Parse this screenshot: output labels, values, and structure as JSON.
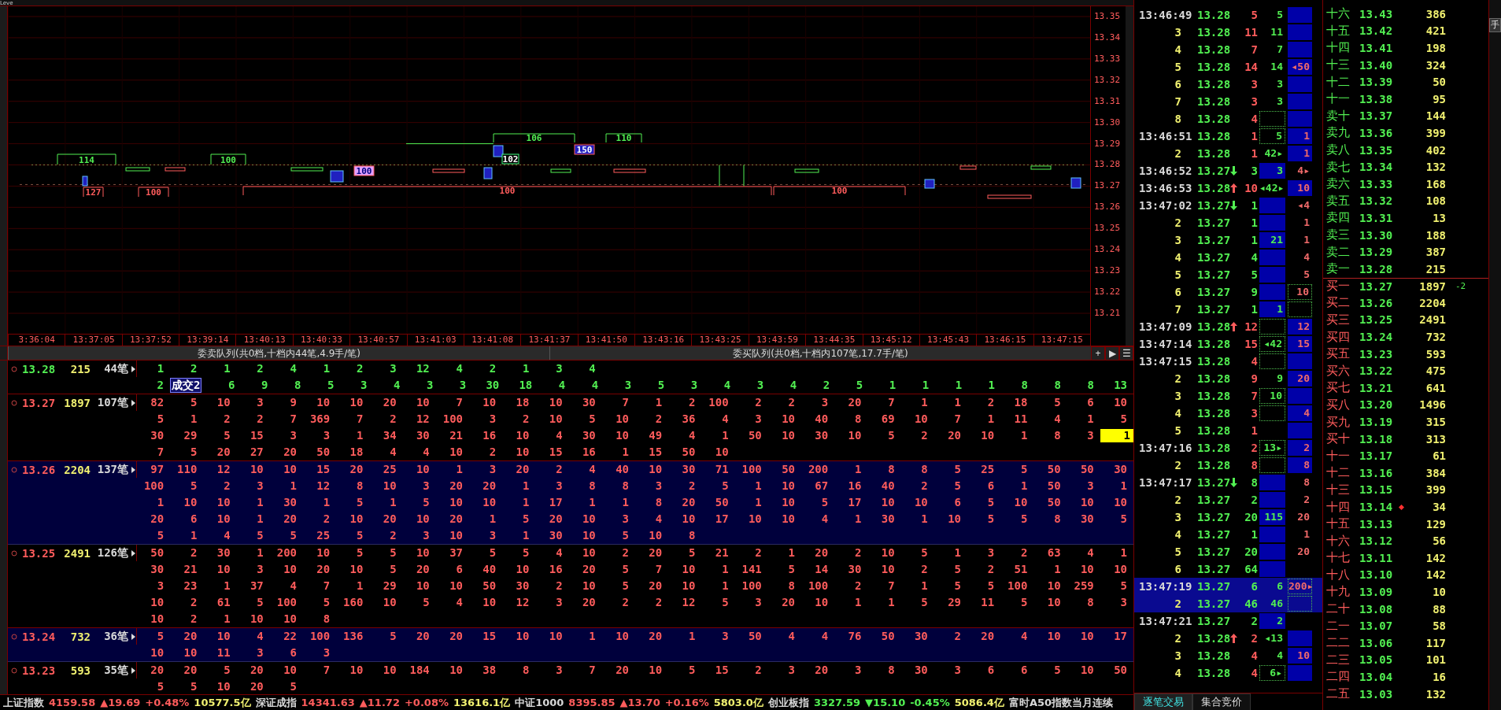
{
  "corner_label": "Leve",
  "chart": {
    "y_axis": [
      "13.35",
      "13.34",
      "13.33",
      "13.32",
      "13.31",
      "13.30",
      "13.29",
      "13.28",
      "13.27",
      "13.26",
      "13.25",
      "13.24",
      "13.23",
      "13.22",
      "13.21"
    ],
    "x_axis": [
      "3:36:04",
      "13:37:05",
      "13:37:52",
      "13:39:14",
      "13:40:13",
      "13:40:33",
      "13:40:57",
      "13:41:03",
      "13:41:08",
      "13:41:37",
      "13:41:50",
      "13:43:16",
      "13:43:25",
      "13:43:59",
      "13:44:35",
      "13:45:12",
      "13:45:43",
      "13:46:15",
      "13:47:15"
    ],
    "blocks": [
      {
        "label": "114",
        "kind": "ask"
      },
      {
        "label": "100",
        "kind": "ask"
      },
      {
        "label": "106",
        "kind": "ask"
      },
      {
        "label": "110",
        "kind": "ask"
      },
      {
        "label": "150",
        "kind": "filled"
      },
      {
        "label": "102",
        "kind": "marked"
      },
      {
        "label": "100",
        "kind": "pink"
      },
      {
        "label": "127",
        "kind": "bid"
      },
      {
        "label": "100",
        "kind": "bid"
      },
      {
        "label": "100",
        "kind": "bid"
      },
      {
        "label": "100",
        "kind": "bid"
      }
    ]
  },
  "queue_header": {
    "sell_title": "委卖队列(共0档,十档内44笔,4.9手/笔)",
    "buy_title": "委买队列(共0档,十档内107笔,17.7手/笔)",
    "buttons": [
      "+",
      "▶",
      "☰"
    ]
  },
  "levels": [
    {
      "price": "13.28",
      "volume": "215",
      "orders": "44笔",
      "kind": "ask",
      "shaded": false,
      "lines": [
        [
          "1",
          "2",
          "1",
          "2",
          "4",
          "1",
          "2",
          "3",
          "12",
          "4",
          "2",
          "1",
          "3",
          "4"
        ],
        [
          "2",
          {
            "text": "成交2",
            "kind": "trade"
          },
          "6",
          "9",
          "8",
          "5",
          "3",
          "4",
          "3",
          "3",
          "30",
          "18",
          "4",
          "4",
          "3",
          "5",
          "3",
          "4",
          "3",
          "4",
          "2",
          "5",
          "1",
          "1",
          "1",
          "1",
          "8",
          "8",
          "8",
          "13"
        ]
      ]
    },
    {
      "price": "13.27",
      "volume": "1897",
      "orders": "107笔",
      "kind": "bid",
      "shaded": false,
      "lines": [
        [
          "82",
          "5",
          "10",
          "3",
          "9",
          "10",
          "10",
          "20",
          "10",
          "7",
          "10",
          "18",
          "10",
          "30",
          "7",
          "1",
          "2",
          "100",
          "2",
          "2",
          "3",
          "20",
          "7",
          "1",
          "1",
          "2",
          "18",
          "5",
          "6",
          "10"
        ],
        [
          "5",
          "1",
          "2",
          "2",
          "7",
          "369",
          "7",
          "2",
          "12",
          "100",
          "3",
          "2",
          "10",
          "5",
          "10",
          "2",
          "36",
          "4",
          "3",
          "10",
          "40",
          "8",
          "69",
          "10",
          "7",
          "1",
          "11",
          "4",
          "1",
          "5"
        ],
        [
          "30",
          "29",
          "5",
          "15",
          "3",
          "3",
          "1",
          "34",
          "30",
          "21",
          "16",
          "10",
          "4",
          "30",
          "10",
          "49",
          "4",
          "1",
          "50",
          "10",
          "30",
          "10",
          "5",
          "2",
          "20",
          "10",
          "1",
          "8",
          "3",
          {
            "text": "1",
            "kind": "cursor"
          }
        ],
        [
          "7",
          "5",
          "20",
          "27",
          "20",
          "50",
          "18",
          "4",
          "4",
          "10",
          "2",
          "10",
          "15",
          "16",
          "1",
          "15",
          "50",
          "10"
        ]
      ]
    },
    {
      "price": "13.26",
      "volume": "2204",
      "orders": "137笔",
      "kind": "bid",
      "shaded": true,
      "lines": [
        [
          "97",
          "110",
          "12",
          "10",
          "10",
          "15",
          "20",
          "25",
          "10",
          "1",
          "3",
          "20",
          "2",
          "4",
          "40",
          "10",
          "30",
          "71",
          "100",
          "50",
          "200",
          "1",
          "8",
          "8",
          "5",
          "25",
          "5",
          "50",
          "50",
          "30"
        ],
        [
          "100",
          "5",
          "2",
          "3",
          "1",
          "12",
          "8",
          "10",
          "3",
          "20",
          "20",
          "1",
          "3",
          "8",
          "8",
          "3",
          "2",
          "5",
          "1",
          "10",
          "67",
          "16",
          "40",
          "2",
          "5",
          "6",
          "1",
          "50",
          "3",
          "1"
        ],
        [
          "1",
          "10",
          "10",
          "1",
          "30",
          "1",
          "5",
          "1",
          "5",
          "10",
          "10",
          "1",
          "17",
          "1",
          "1",
          "8",
          "20",
          "50",
          "1",
          "10",
          "5",
          "17",
          "10",
          "10",
          "6",
          "5",
          "10",
          "50",
          "10",
          "10"
        ],
        [
          "20",
          "6",
          "10",
          "1",
          "20",
          "2",
          "10",
          "20",
          "10",
          "20",
          "1",
          "5",
          "20",
          "10",
          "3",
          "4",
          "10",
          "17",
          "10",
          "10",
          "4",
          "1",
          "30",
          "1",
          "10",
          "5",
          "5",
          "8",
          "30",
          "5"
        ],
        [
          "5",
          "1",
          "4",
          "5",
          "5",
          "25",
          "5",
          "2",
          "3",
          "10",
          "3",
          "1",
          "30",
          "10",
          "5",
          "10",
          "8"
        ]
      ]
    },
    {
      "price": "13.25",
      "volume": "2491",
      "orders": "126笔",
      "kind": "bid",
      "shaded": false,
      "lines": [
        [
          "50",
          "2",
          "30",
          "1",
          "200",
          "10",
          "5",
          "5",
          "10",
          "37",
          "5",
          "5",
          "4",
          "10",
          "2",
          "20",
          "5",
          "21",
          "2",
          "1",
          "20",
          "2",
          "10",
          "5",
          "1",
          "3",
          "2",
          "63",
          "4",
          "1"
        ],
        [
          "30",
          "21",
          "10",
          "3",
          "10",
          "20",
          "10",
          "5",
          "20",
          "6",
          "40",
          "10",
          "16",
          "20",
          "5",
          "7",
          "10",
          "1",
          "141",
          "5",
          "14",
          "30",
          "10",
          "2",
          "5",
          "2",
          "51",
          "1",
          "10",
          "10"
        ],
        [
          "3",
          "23",
          "1",
          "37",
          "4",
          "7",
          "1",
          "29",
          "10",
          "10",
          "50",
          "30",
          "2",
          "10",
          "5",
          "20",
          "10",
          "1",
          "100",
          "8",
          "100",
          "2",
          "7",
          "1",
          "5",
          "5",
          "100",
          "10",
          "259",
          "5"
        ],
        [
          "10",
          "2",
          "61",
          "5",
          "100",
          "5",
          "160",
          "10",
          "5",
          "4",
          "10",
          "12",
          "3",
          "20",
          "2",
          "2",
          "12",
          "5",
          "3",
          "20",
          "10",
          "1",
          "1",
          "5",
          "29",
          "11",
          "5",
          "10",
          "8",
          "3"
        ],
        [
          "10",
          "2",
          "1",
          "10",
          "10",
          "8"
        ]
      ]
    },
    {
      "price": "13.24",
      "volume": "732",
      "orders": "36笔",
      "kind": "bid",
      "shaded": true,
      "lines": [
        [
          "5",
          "20",
          "10",
          "4",
          "22",
          "100",
          "136",
          "5",
          "20",
          "20",
          "15",
          "10",
          "10",
          "1",
          "10",
          "20",
          "1",
          "3",
          "50",
          "4",
          "4",
          "76",
          "50",
          "30",
          "2",
          "20",
          "4",
          "10",
          "10",
          "17"
        ],
        [
          "10",
          "10",
          "11",
          "3",
          "6",
          "3"
        ]
      ]
    },
    {
      "price": "13.23",
      "volume": "593",
      "orders": "35笔",
      "kind": "bid",
      "shaded": false,
      "lines": [
        [
          "20",
          "20",
          "5",
          "20",
          "10",
          "7",
          "10",
          "10",
          "184",
          "10",
          "38",
          "8",
          "3",
          "7",
          "20",
          "10",
          "5",
          "15",
          "2",
          "3",
          "20",
          "3",
          "8",
          "30",
          "3",
          "6",
          "6",
          "5",
          "10",
          "50"
        ],
        [
          "5",
          "5",
          "10",
          "20",
          "5"
        ]
      ]
    }
  ],
  "status_bar": [
    {
      "text": "上证指数",
      "kind": "name"
    },
    {
      "text": "4159.58",
      "kind": "up"
    },
    {
      "text": "▲19.69",
      "kind": "up"
    },
    {
      "text": "+0.48%",
      "kind": "up"
    },
    {
      "text": "10577.5亿",
      "kind": "amount"
    },
    {
      "text": "深证成指",
      "kind": "name"
    },
    {
      "text": "14341.63",
      "kind": "up"
    },
    {
      "text": "▲11.72",
      "kind": "up"
    },
    {
      "text": "+0.08%",
      "kind": "up"
    },
    {
      "text": "13616.1亿",
      "kind": "amount"
    },
    {
      "text": "中证1000",
      "kind": "name"
    },
    {
      "text": "8395.85",
      "kind": "up"
    },
    {
      "text": "▲13.70",
      "kind": "up"
    },
    {
      "text": "+0.16%",
      "kind": "up"
    },
    {
      "text": "5803.0亿",
      "kind": "amount"
    },
    {
      "text": "创业板指",
      "kind": "name"
    },
    {
      "text": "3327.59",
      "kind": "down"
    },
    {
      "text": "▼15.10",
      "kind": "down"
    },
    {
      "text": "-0.45%",
      "kind": "down"
    },
    {
      "text": "5086.4亿",
      "kind": "amount"
    },
    {
      "text": "富时A50指数当月连续",
      "kind": "name"
    }
  ],
  "ticks": [
    {
      "time": "13:46:49",
      "kind": "time",
      "price": "13.28",
      "rising": false,
      "falling": false,
      "volume": "5",
      "buyer": true,
      "buy_hand": {
        "text": "5",
        "kind": "plain"
      },
      "sell_hand": {
        "kind": "solid"
      },
      "selected": false
    },
    {
      "time": "3",
      "kind": "seq",
      "price": "13.28",
      "rising": false,
      "falling": false,
      "volume": "11",
      "buyer": true,
      "buy_hand": {
        "text": "11",
        "kind": "plain"
      },
      "sell_hand": {
        "kind": "solid"
      },
      "selected": false
    },
    {
      "time": "4",
      "kind": "seq",
      "price": "13.28",
      "rising": false,
      "falling": false,
      "volume": "7",
      "buyer": true,
      "buy_hand": {
        "text": "7",
        "kind": "plain"
      },
      "sell_hand": {
        "kind": "solid"
      },
      "selected": false
    },
    {
      "time": "5",
      "kind": "seq",
      "price": "13.28",
      "rising": false,
      "falling": false,
      "volume": "14",
      "buyer": true,
      "buy_hand": {
        "text": "14",
        "kind": "plain"
      },
      "sell_hand": {
        "text": "◂50",
        "kind": "solid"
      },
      "selected": false
    },
    {
      "time": "6",
      "kind": "seq",
      "price": "13.28",
      "rising": false,
      "falling": false,
      "volume": "3",
      "buyer": true,
      "buy_hand": {
        "text": "3",
        "kind": "plain"
      },
      "sell_hand": {
        "kind": "solid"
      },
      "selected": false
    },
    {
      "time": "7",
      "kind": "seq",
      "price": "13.28",
      "rising": false,
      "falling": false,
      "volume": "3",
      "buyer": true,
      "buy_hand": {
        "text": "3",
        "kind": "plain"
      },
      "sell_hand": {
        "kind": "solid"
      },
      "selected": false
    },
    {
      "time": "8",
      "kind": "seq",
      "price": "13.28",
      "rising": false,
      "falling": false,
      "volume": "4",
      "buyer": true,
      "buy_hand": {
        "kind": "dotted"
      },
      "sell_hand": {
        "kind": "solid"
      },
      "selected": false
    },
    {
      "time": "13:46:51",
      "kind": "time",
      "price": "13.28",
      "rising": false,
      "falling": false,
      "volume": "1",
      "buyer": true,
      "buy_hand": {
        "text": "5",
        "kind": "dotted"
      },
      "sell_hand": {
        "text": "1",
        "kind": "solid"
      },
      "selected": false
    },
    {
      "time": "2",
      "kind": "seq",
      "price": "13.28",
      "rising": false,
      "falling": false,
      "volume": "1",
      "buyer": true,
      "buy_hand": {
        "text": "42▸",
        "kind": "plain"
      },
      "sell_hand": {
        "text": "1",
        "kind": "solid"
      },
      "selected": false
    },
    {
      "time": "13:46:52",
      "kind": "time",
      "price": "13.27",
      "rising": false,
      "falling": true,
      "volume": "3",
      "buyer": false,
      "buy_hand": {
        "text": "3",
        "kind": "solid"
      },
      "sell_hand": {
        "text": "4▸",
        "kind": "plain"
      },
      "selected": false
    },
    {
      "time": "13:46:53",
      "kind": "time",
      "price": "13.28",
      "rising": true,
      "falling": false,
      "volume": "10",
      "buyer": true,
      "buy_hand": {
        "text": "◂42▸",
        "kind": "plain"
      },
      "sell_hand": {
        "text": "10",
        "kind": "solid"
      },
      "selected": false
    },
    {
      "time": "13:47:02",
      "kind": "time",
      "price": "13.27",
      "rising": false,
      "falling": true,
      "volume": "1",
      "buyer": false,
      "buy_hand": {
        "kind": "solid"
      },
      "sell_hand": {
        "text": "◂4",
        "kind": "plain"
      },
      "selected": false
    },
    {
      "time": "2",
      "kind": "seq",
      "price": "13.27",
      "rising": false,
      "falling": false,
      "volume": "1",
      "buyer": false,
      "buy_hand": {
        "kind": "solid"
      },
      "sell_hand": {
        "text": "1",
        "kind": "plain"
      },
      "selected": false
    },
    {
      "time": "3",
      "kind": "seq",
      "price": "13.27",
      "rising": false,
      "falling": false,
      "volume": "1",
      "buyer": false,
      "buy_hand": {
        "text": "21",
        "kind": "solid"
      },
      "sell_hand": {
        "text": "1",
        "kind": "plain"
      },
      "selected": false
    },
    {
      "time": "4",
      "kind": "seq",
      "price": "13.27",
      "rising": false,
      "falling": false,
      "volume": "4",
      "buyer": false,
      "buy_hand": {
        "kind": "solid"
      },
      "sell_hand": {
        "text": "4",
        "kind": "plain"
      },
      "selected": false
    },
    {
      "time": "5",
      "kind": "seq",
      "price": "13.27",
      "rising": false,
      "falling": false,
      "volume": "5",
      "buyer": false,
      "buy_hand": {
        "kind": "solid"
      },
      "sell_hand": {
        "text": "5",
        "kind": "plain"
      },
      "selected": false
    },
    {
      "time": "6",
      "kind": "seq",
      "price": "13.27",
      "rising": false,
      "falling": false,
      "volume": "9",
      "buyer": false,
      "buy_hand": {
        "kind": "solid"
      },
      "sell_hand": {
        "text": "10",
        "kind": "dotted"
      },
      "selected": false
    },
    {
      "time": "7",
      "kind": "seq",
      "price": "13.27",
      "rising": false,
      "falling": false,
      "volume": "1",
      "buyer": false,
      "buy_hand": {
        "text": "1",
        "kind": "solid"
      },
      "sell_hand": {
        "kind": "dotted"
      },
      "selected": false
    },
    {
      "time": "13:47:09",
      "kind": "time",
      "price": "13.28",
      "rising": true,
      "falling": false,
      "volume": "12",
      "buyer": true,
      "buy_hand": {
        "kind": "dotted"
      },
      "sell_hand": {
        "text": "12",
        "kind": "solid"
      },
      "selected": false
    },
    {
      "time": "13:47:14",
      "kind": "time",
      "price": "13.28",
      "rising": false,
      "falling": false,
      "volume": "15",
      "buyer": true,
      "buy_hand": {
        "text": "◂42",
        "kind": "dotted"
      },
      "sell_hand": {
        "text": "15",
        "kind": "solid"
      },
      "selected": false
    },
    {
      "time": "13:47:15",
      "kind": "time",
      "price": "13.28",
      "rising": false,
      "falling": false,
      "volume": "4",
      "buyer": true,
      "buy_hand": {
        "kind": "dotted"
      },
      "sell_hand": {
        "kind": "solid"
      },
      "selected": false
    },
    {
      "time": "2",
      "kind": "seq",
      "price": "13.28",
      "rising": false,
      "falling": false,
      "volume": "9",
      "buyer": true,
      "buy_hand": {
        "text": "9",
        "kind": "plain"
      },
      "sell_hand": {
        "text": "20",
        "kind": "solid"
      },
      "selected": false
    },
    {
      "time": "3",
      "kind": "seq",
      "price": "13.28",
      "rising": false,
      "falling": false,
      "volume": "7",
      "buyer": true,
      "buy_hand": {
        "text": "10",
        "kind": "dotted"
      },
      "sell_hand": {
        "kind": "solid"
      },
      "selected": false
    },
    {
      "time": "4",
      "kind": "seq",
      "price": "13.28",
      "rising": false,
      "falling": false,
      "volume": "3",
      "buyer": true,
      "buy_hand": {
        "kind": "dotted"
      },
      "sell_hand": {
        "text": "4",
        "kind": "solid"
      },
      "selected": false
    },
    {
      "time": "5",
      "kind": "seq",
      "price": "13.28",
      "rising": false,
      "falling": false,
      "volume": "1",
      "buyer": true,
      "sell_hand": {
        "kind": "solid"
      },
      "selected": false
    },
    {
      "time": "13:47:16",
      "kind": "time",
      "price": "13.28",
      "rising": false,
      "falling": false,
      "volume": "2",
      "buyer": true,
      "buy_hand": {
        "text": "13▸",
        "kind": "dotted"
      },
      "sell_hand": {
        "text": "2",
        "kind": "solid"
      },
      "selected": false
    },
    {
      "time": "2",
      "kind": "seq",
      "price": "13.28",
      "rising": false,
      "falling": false,
      "volume": "8",
      "buyer": true,
      "buy_hand": {
        "kind": "dotted"
      },
      "sell_hand": {
        "text": "8",
        "kind": "solid"
      },
      "selected": false
    },
    {
      "time": "13:47:17",
      "kind": "time",
      "price": "13.27",
      "rising": false,
      "falling": true,
      "volume": "8",
      "buyer": false,
      "buy_hand": {
        "kind": "solid"
      },
      "sell_hand": {
        "text": "8",
        "kind": "plain"
      },
      "selected": false
    },
    {
      "time": "2",
      "kind": "seq",
      "price": "13.27",
      "rising": false,
      "falling": false,
      "volume": "2",
      "buyer": false,
      "buy_hand": {
        "kind": "solid"
      },
      "sell_hand": {
        "text": "2",
        "kind": "plain"
      },
      "selected": false
    },
    {
      "time": "3",
      "kind": "seq",
      "price": "13.27",
      "rising": false,
      "falling": false,
      "volume": "20",
      "buyer": false,
      "buy_hand": {
        "text": "115",
        "kind": "solid"
      },
      "sell_hand": {
        "text": "20",
        "kind": "plain"
      },
      "selected": false
    },
    {
      "time": "4",
      "kind": "seq",
      "price": "13.27",
      "rising": false,
      "falling": false,
      "volume": "1",
      "buyer": false,
      "buy_hand": {
        "kind": "solid"
      },
      "sell_hand": {
        "text": "1",
        "kind": "plain"
      },
      "selected": false
    },
    {
      "time": "5",
      "kind": "seq",
      "price": "13.27",
      "rising": false,
      "falling": false,
      "volume": "20",
      "buyer": false,
      "buy_hand": {
        "kind": "solid"
      },
      "sell_hand": {
        "text": "20",
        "kind": "plain"
      },
      "selected": false
    },
    {
      "time": "6",
      "kind": "seq",
      "price": "13.27",
      "rising": false,
      "falling": false,
      "volume": "64",
      "buyer": false,
      "buy_hand": {
        "kind": "solid"
      },
      "selected": false
    },
    {
      "time": "13:47:19",
      "kind": "time",
      "price": "13.27",
      "rising": false,
      "falling": false,
      "volume": "6",
      "buyer": false,
      "buy_hand": {
        "text": "6",
        "kind": "plain"
      },
      "sell_hand": {
        "text": "200▸",
        "kind": "dotted"
      },
      "selected": true
    },
    {
      "time": "2",
      "kind": "seq",
      "price": "13.27",
      "rising": false,
      "falling": false,
      "volume": "46",
      "buyer": false,
      "buy_hand": {
        "text": "46",
        "kind": "plain"
      },
      "sell_hand": {
        "kind": "dotted"
      },
      "selected": true
    },
    {
      "time": "13:47:21",
      "kind": "time",
      "price": "13.27",
      "rising": false,
      "falling": false,
      "volume": "2",
      "buyer": false,
      "buy_hand": {
        "text": "2",
        "kind": "solid"
      },
      "selected": false
    },
    {
      "time": "2",
      "kind": "seq",
      "price": "13.28",
      "rising": true,
      "falling": false,
      "volume": "2",
      "buyer": true,
      "buy_hand": {
        "text": "◂13",
        "kind": "plain"
      },
      "sell_hand": {
        "kind": "solid"
      },
      "selected": false
    },
    {
      "time": "3",
      "kind": "seq",
      "price": "13.28",
      "rising": false,
      "falling": false,
      "volume": "4",
      "buyer": true,
      "buy_hand": {
        "text": "4",
        "kind": "plain"
      },
      "sell_hand": {
        "text": "10",
        "kind": "solid"
      },
      "selected": false
    },
    {
      "time": "4",
      "kind": "seq",
      "price": "13.28",
      "rising": false,
      "falling": false,
      "volume": "4",
      "buyer": true,
      "buy_hand": {
        "text": "6▸",
        "kind": "dotted"
      },
      "sell_hand": {
        "kind": "solid"
      },
      "selected": false
    }
  ],
  "tick_tabs": [
    {
      "label": "逐笔交易",
      "selected": true
    },
    {
      "label": "集合竞价",
      "selected": false
    }
  ],
  "order_book": {
    "unit_button": "手",
    "asks": [
      {
        "label": "十六",
        "price": "13.43",
        "volume": "386"
      },
      {
        "label": "十五",
        "price": "13.42",
        "volume": "421"
      },
      {
        "label": "十四",
        "price": "13.41",
        "volume": "198"
      },
      {
        "label": "十三",
        "price": "13.40",
        "volume": "324"
      },
      {
        "label": "十二",
        "price": "13.39",
        "volume": "50"
      },
      {
        "label": "十一",
        "price": "13.38",
        "volume": "95"
      },
      {
        "label": "卖十",
        "price": "13.37",
        "volume": "144"
      },
      {
        "label": "卖九",
        "price": "13.36",
        "volume": "399"
      },
      {
        "label": "卖八",
        "price": "13.35",
        "volume": "402"
      },
      {
        "label": "卖七",
        "price": "13.34",
        "volume": "132"
      },
      {
        "label": "卖六",
        "price": "13.33",
        "volume": "168"
      },
      {
        "label": "卖五",
        "price": "13.32",
        "volume": "108"
      },
      {
        "label": "卖四",
        "price": "13.31",
        "volume": "13"
      },
      {
        "label": "卖三",
        "price": "13.30",
        "volume": "188"
      },
      {
        "label": "卖二",
        "price": "13.29",
        "volume": "387"
      },
      {
        "label": "卖一",
        "price": "13.28",
        "volume": "215"
      }
    ],
    "bids": [
      {
        "label": "买一",
        "price": "13.27",
        "volume": "1897",
        "change": "-2",
        "flag": false
      },
      {
        "label": "买二",
        "price": "13.26",
        "volume": "2204",
        "flag": false
      },
      {
        "label": "买三",
        "price": "13.25",
        "volume": "2491",
        "flag": false
      },
      {
        "label": "买四",
        "price": "13.24",
        "volume": "732",
        "flag": false
      },
      {
        "label": "买五",
        "price": "13.23",
        "volume": "593",
        "flag": false
      },
      {
        "label": "买六",
        "price": "13.22",
        "volume": "475",
        "flag": false
      },
      {
        "label": "买七",
        "price": "13.21",
        "volume": "641",
        "flag": false
      },
      {
        "label": "买八",
        "price": "13.20",
        "volume": "1496",
        "flag": false
      },
      {
        "label": "买九",
        "price": "13.19",
        "volume": "315",
        "flag": false
      },
      {
        "label": "买十",
        "price": "13.18",
        "volume": "313",
        "flag": false
      },
      {
        "label": "十一",
        "price": "13.17",
        "volume": "61",
        "flag": false
      },
      {
        "label": "十二",
        "price": "13.16",
        "volume": "384",
        "flag": false
      },
      {
        "label": "十三",
        "price": "13.15",
        "volume": "399",
        "flag": false
      },
      {
        "label": "十四",
        "price": "13.14",
        "volume": "34",
        "flag": true
      },
      {
        "label": "十五",
        "price": "13.13",
        "volume": "129",
        "flag": false
      },
      {
        "label": "十六",
        "price": "13.12",
        "volume": "56",
        "flag": false
      },
      {
        "label": "十七",
        "price": "13.11",
        "volume": "142",
        "flag": false
      },
      {
        "label": "十八",
        "price": "13.10",
        "volume": "142",
        "flag": false
      },
      {
        "label": "十九",
        "price": "13.09",
        "volume": "10",
        "flag": false
      },
      {
        "label": "二十",
        "price": "13.08",
        "volume": "88",
        "flag": false
      },
      {
        "label": "二一",
        "price": "13.07",
        "volume": "58",
        "flag": false
      },
      {
        "label": "二二",
        "price": "13.06",
        "volume": "117",
        "flag": false
      },
      {
        "label": "二三",
        "price": "13.05",
        "volume": "101",
        "flag": false
      },
      {
        "label": "二四",
        "price": "13.04",
        "volume": "16",
        "flag": false
      },
      {
        "label": "二五",
        "price": "13.03",
        "volume": "132",
        "flag": false
      }
    ]
  }
}
